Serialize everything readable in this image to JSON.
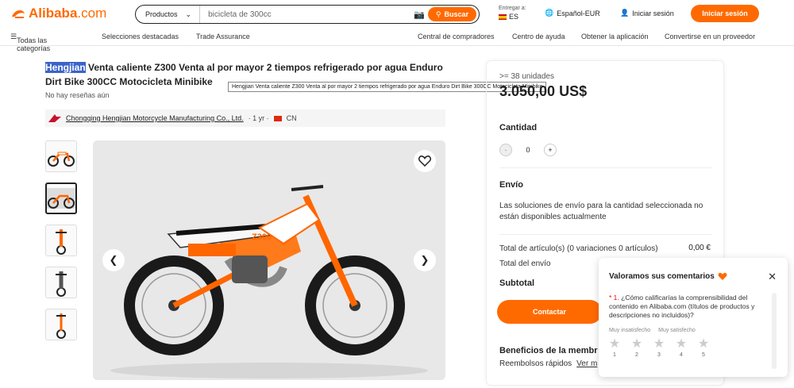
{
  "header": {
    "logo": "Alibaba",
    "logo_suffix": ".com",
    "search_category": "Productos",
    "search_placeholder": "bicicleta de 300cc",
    "search_button": "Buscar",
    "deliver_to_label": "Entregar a:",
    "deliver_country": "ES",
    "language_currency": "Español-EUR",
    "login_label": "Iniciar sesión",
    "signin_button": "Iniciar sesión"
  },
  "nav": {
    "categories": "Todas las categorías",
    "featured": "Selecciones destacadas",
    "trade_assurance": "Trade Assurance",
    "buyer_central": "Central de compradores",
    "help_center": "Centro de ayuda",
    "get_app": "Obtener la aplicación",
    "become_supplier": "Convertirse en un proveedor"
  },
  "product": {
    "title_highlight": "Hengjian",
    "title_rest": " Venta caliente Z300 Venta al por mayor 2 tiempos refrigerado por agua Enduro Dirt Bike 300CC Motocicleta Minibike",
    "reviews": "No hay reseñas aún",
    "tooltip": "Hengjian Venta caliente Z300 Venta al por mayor 2 tiempos refrigerado por agua Enduro Dirt Bike 300CC Motocicleta Minibike",
    "supplier_name": "Chongqing Hengjian Motorcycle Manufacturing Co., Ltd.",
    "supplier_years": "· 1 yr ·",
    "supplier_country": "CN"
  },
  "panel": {
    "min_units": ">= 38 unidades",
    "price": "3.050,00 US$",
    "quantity_label": "Cantidad",
    "quantity_value": "0",
    "minus": "-",
    "plus": "+",
    "shipping_label": "Envío",
    "shipping_text": "Las soluciones de envío para la cantidad seleccionada no están disponibles actualmente",
    "items_total_label": "Total de artículo(s) (0 variaciones 0 artículos)",
    "items_total_value": "0,00 €",
    "shipping_total_label": "Total del envío",
    "subtotal_label": "Subtotal",
    "contact_button": "Contactar",
    "benefits_label": "Beneficios de la membr",
    "refunds": "Reembolsos rápidos",
    "see_more": "Ver m"
  },
  "feedback": {
    "title": "Valoramos sus comentarios",
    "question_number": "* 1.",
    "question": "¿Cómo calificarías la comprensibilidad del contenido en Alibaba.com (títulos de productos y descripciones no incluidos)?",
    "low_label": "Muy insatisfecho",
    "high_label": "Muy satisfecho",
    "ratings": [
      "1",
      "2",
      "3",
      "4",
      "5"
    ]
  },
  "colors": {
    "accent": "#ff6a00",
    "highlight": "#3b64c9"
  }
}
